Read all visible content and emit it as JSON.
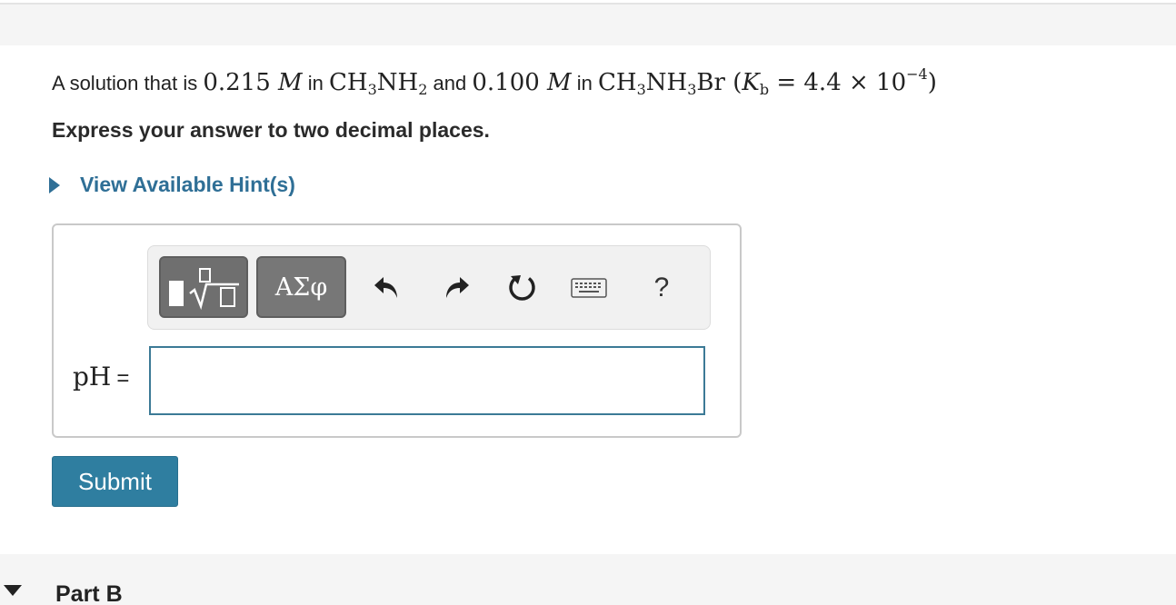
{
  "question": {
    "intro": "A solution that is ",
    "conc1": "0.215",
    "unit1": "M",
    "in1": " in ",
    "base_c": "CH",
    "base_sub1": "3",
    "base_n": "NH",
    "base_sub2": "2",
    "and": " and ",
    "conc2": "0.100",
    "unit2": "M",
    "in2": " in ",
    "salt_c": "CH",
    "salt_sub1": "3",
    "salt_n": "NH",
    "salt_sub2": "3",
    "salt_br": "Br",
    "kb_open": " (",
    "kb_k": "K",
    "kb_sub": "b",
    "kb_eq": " = 4.4 × 10",
    "kb_exp": "−4",
    "kb_close": ")"
  },
  "instruction": "Express your answer to two decimal places.",
  "hint": {
    "label": "View Available Hint(s)"
  },
  "toolbar": {
    "templates_icon": "templates-sqrt-icon",
    "greek_label": "ΑΣφ",
    "undo_icon": "undo-icon",
    "redo_icon": "redo-icon",
    "reset_icon": "reset-icon",
    "keyboard_icon": "keyboard-icon",
    "help_label": "?"
  },
  "answer": {
    "label": "pH",
    "equals": "=",
    "value": "",
    "placeholder": ""
  },
  "submit_label": "Submit",
  "next_part": {
    "title": "Part B"
  },
  "colors": {
    "link": "#2f6f96",
    "submit": "#2f7ea0",
    "input_border": "#3c7a96",
    "toolbar_button": "#777777"
  }
}
